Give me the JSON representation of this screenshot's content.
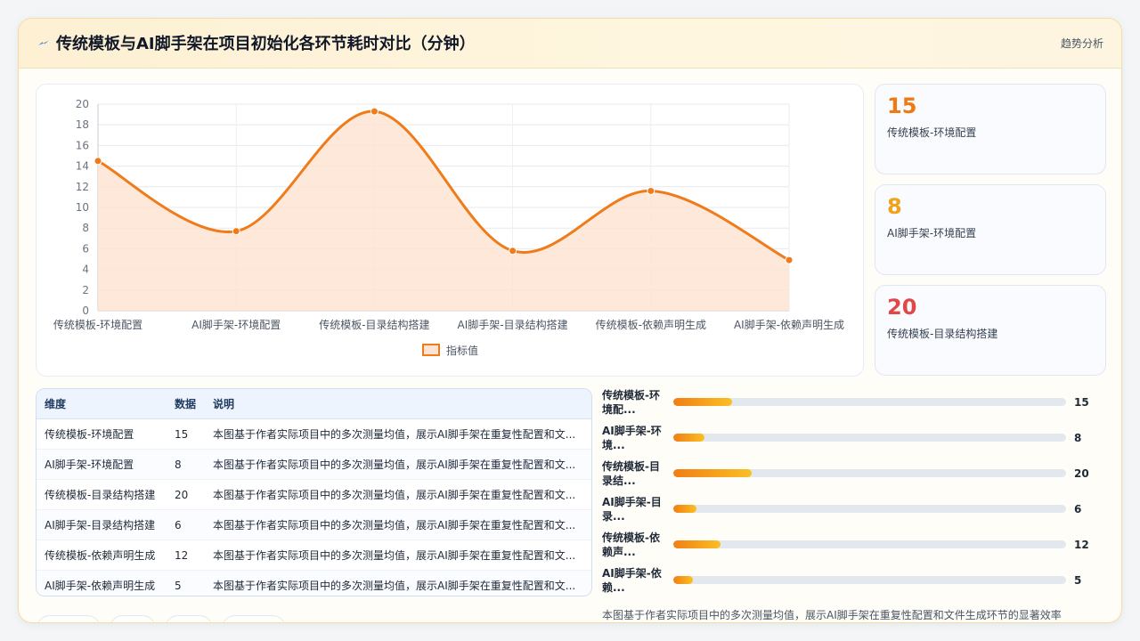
{
  "header": {
    "title": "传统模板与AI脚手架在项目初始化各环节耗时对比（分钟）",
    "link": "趋势分析"
  },
  "colors": {
    "line": "#ef7b1a",
    "area": "#fde4d2",
    "accent_orange": "#f07a12",
    "accent_amber": "#f0a21d",
    "accent_red": "#e04848"
  },
  "chart_data": {
    "type": "line",
    "categories": [
      "传统模板-环境配置",
      "AI脚手架-环境配置",
      "传统模板-目录结构搭建",
      "AI脚手架-目录结构搭建",
      "传统模板-依赖声明生成",
      "AI脚手架-依赖声明生成"
    ],
    "series": [
      {
        "name": "指标值",
        "values": [
          14.5,
          7.7,
          19.3,
          5.8,
          11.6,
          4.9
        ]
      }
    ],
    "ylim": [
      0,
      20
    ],
    "yticks": [
      0,
      2,
      4,
      6,
      8,
      10,
      12,
      14,
      16,
      18,
      20
    ],
    "grid": true,
    "legend": "bottom",
    "smooth": true,
    "fill": true
  },
  "stats": [
    {
      "value": "15",
      "label": "传统模板-环境配置"
    },
    {
      "value": "8",
      "label": "AI脚手架-环境配置"
    },
    {
      "value": "20",
      "label": "传统模板-目录结构搭建"
    }
  ],
  "table": {
    "headers": [
      "维度",
      "数据",
      "说明"
    ],
    "rows": [
      {
        "dim": "传统模板-环境配置",
        "val": "15",
        "desc": "本图基于作者实际项目中的多次测量均值，展示AI脚手架在重复性配置和文..."
      },
      {
        "dim": "AI脚手架-环境配置",
        "val": "8",
        "desc": "本图基于作者实际项目中的多次测量均值，展示AI脚手架在重复性配置和文..."
      },
      {
        "dim": "传统模板-目录结构搭建",
        "val": "20",
        "desc": "本图基于作者实际项目中的多次测量均值，展示AI脚手架在重复性配置和文..."
      },
      {
        "dim": "AI脚手架-目录结构搭建",
        "val": "6",
        "desc": "本图基于作者实际项目中的多次测量均值，展示AI脚手架在重复性配置和文..."
      },
      {
        "dim": "传统模板-依赖声明生成",
        "val": "12",
        "desc": "本图基于作者实际项目中的多次测量均值，展示AI脚手架在重复性配置和文..."
      },
      {
        "dim": "AI脚手架-依赖声明生成",
        "val": "5",
        "desc": "本图基于作者实际项目中的多次测量均值，展示AI脚手架在重复性配置和文..."
      }
    ]
  },
  "bars": {
    "max": 100,
    "items": [
      {
        "name": "传统模板-环境配...",
        "value": 15
      },
      {
        "name": "AI脚手架-环境...",
        "value": 8
      },
      {
        "name": "传统模板-目录结...",
        "value": 20
      },
      {
        "name": "AI脚手架-目录...",
        "value": 6
      },
      {
        "name": "传统模板-依赖声...",
        "value": 12
      },
      {
        "name": "AI脚手架-依赖...",
        "value": 5
      }
    ]
  },
  "footnote": "本图基于作者实际项目中的多次测量均值，展示AI脚手架在重复性配置和文件生成环节的显著效率"
}
